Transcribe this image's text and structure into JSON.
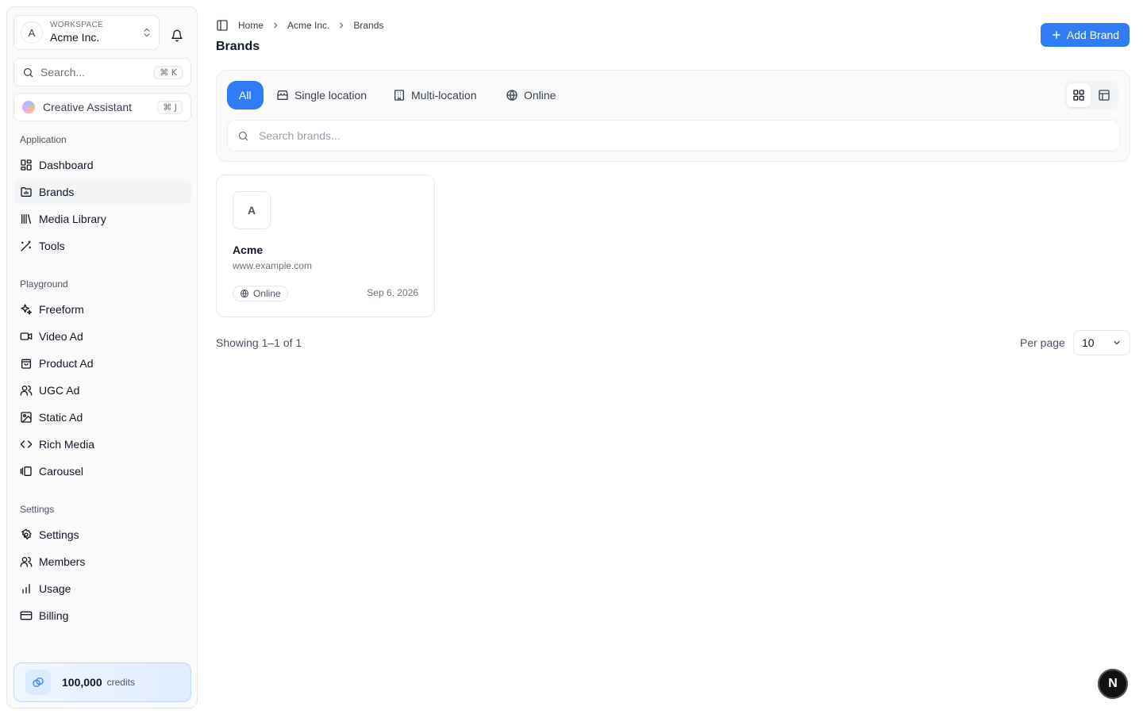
{
  "sidebar": {
    "workspace": {
      "label": "WORKSPACE",
      "name": "Acme Inc.",
      "avatar": "A"
    },
    "search": {
      "placeholder": "Search...",
      "shortcut": "⌘ K"
    },
    "assistant": {
      "label": "Creative Assistant",
      "shortcut": "⌘ J"
    },
    "sections": [
      {
        "title": "Application",
        "items": [
          {
            "label": "Dashboard",
            "icon": "dashboard-icon"
          },
          {
            "label": "Brands",
            "icon": "brands-icon",
            "active": true
          },
          {
            "label": "Media Library",
            "icon": "library-icon"
          },
          {
            "label": "Tools",
            "icon": "wand-icon"
          }
        ]
      },
      {
        "title": "Playground",
        "items": [
          {
            "label": "Freeform",
            "icon": "sparkles-icon"
          },
          {
            "label": "Video Ad",
            "icon": "video-icon"
          },
          {
            "label": "Product Ad",
            "icon": "shopping-bag-icon"
          },
          {
            "label": "UGC Ad",
            "icon": "users-icon"
          },
          {
            "label": "Static Ad",
            "icon": "image-icon"
          },
          {
            "label": "Rich Media",
            "icon": "code-icon"
          },
          {
            "label": "Carousel",
            "icon": "carousel-icon"
          }
        ]
      },
      {
        "title": "Settings",
        "items": [
          {
            "label": "Settings",
            "icon": "gear-icon"
          },
          {
            "label": "Members",
            "icon": "users-icon"
          },
          {
            "label": "Usage",
            "icon": "bar-chart-icon"
          },
          {
            "label": "Billing",
            "icon": "credit-card-icon"
          }
        ]
      }
    ],
    "credits": {
      "amount": "100,000",
      "unit": "credits"
    }
  },
  "header": {
    "breadcrumbs": [
      "Home",
      "Acme Inc.",
      "Brands"
    ],
    "title": "Brands",
    "add_button": "Add Brand"
  },
  "filters": {
    "tabs": [
      {
        "label": "All",
        "active": true
      },
      {
        "label": "Single location",
        "icon": "store-icon"
      },
      {
        "label": "Multi-location",
        "icon": "building-icon"
      },
      {
        "label": "Online",
        "icon": "globe-icon"
      }
    ],
    "search_placeholder": "Search brands...",
    "view": "grid"
  },
  "brands": [
    {
      "initial": "A",
      "name": "Acme",
      "url": "www.example.com",
      "type": "Online",
      "date": "Sep 6, 2026"
    }
  ],
  "pagination": {
    "showing": "Showing 1–1 of 1",
    "per_page_label": "Per page",
    "per_page": "10"
  },
  "floating_badge": "N",
  "colors": {
    "accent": "#2f7cf6",
    "credits_bg": "#eff6ff"
  }
}
